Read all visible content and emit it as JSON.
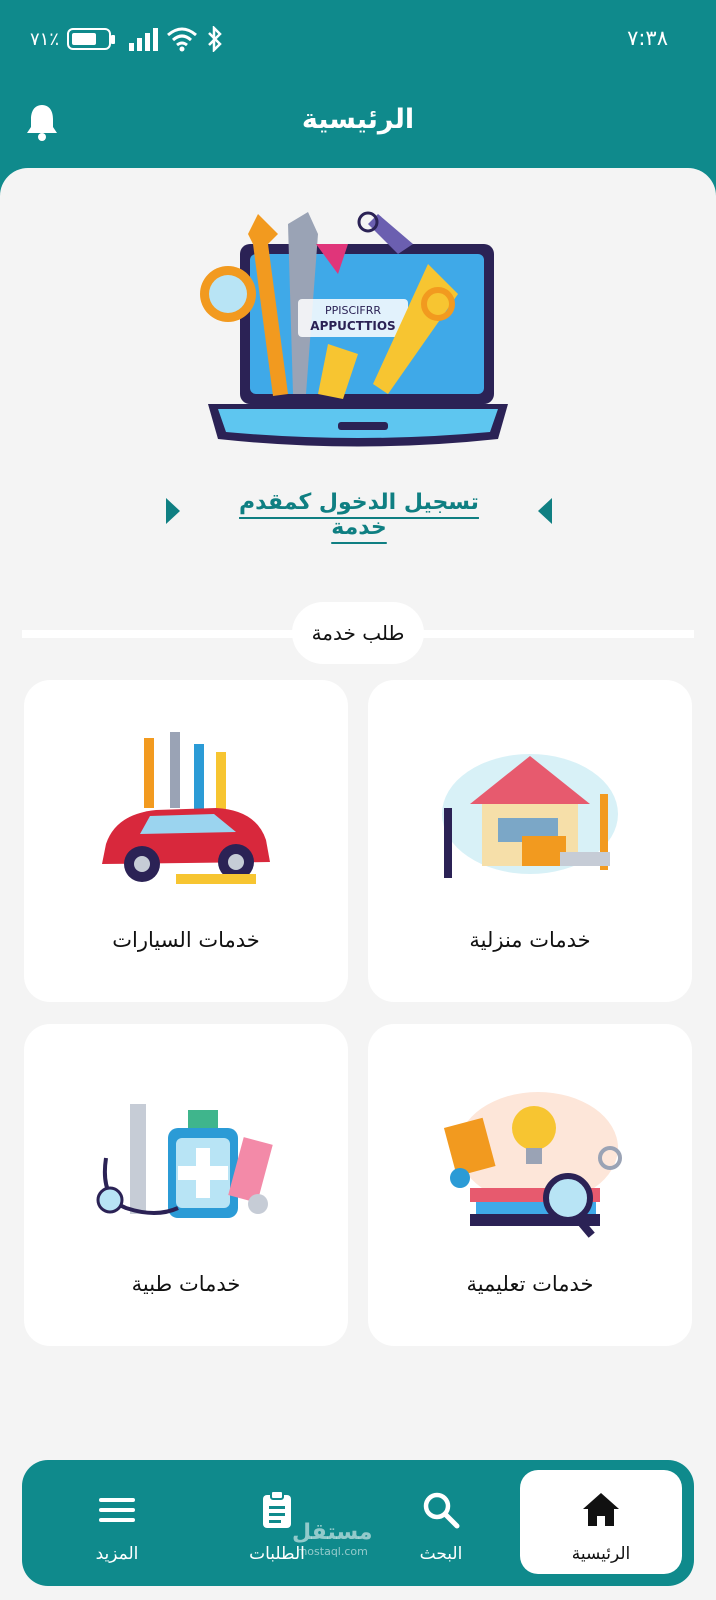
{
  "status_bar": {
    "time": "٧:٣٨",
    "battery_percent_label": "٧١٪",
    "battery_level": 0.71
  },
  "header": {
    "title": "الرئيسية",
    "notification_icon": "bell-icon"
  },
  "hero": {
    "image_text_line1": "PPISCIFRR",
    "image_text_line2": "APPUCTTIOS"
  },
  "login": {
    "link_text": "تسجيل الدخول كمقدم خدمة"
  },
  "section": {
    "title": "طلب خدمة"
  },
  "services": [
    {
      "label": "خدمات منزلية",
      "icon": "home-tools-illustration"
    },
    {
      "label": "خدمات السيارات",
      "icon": "car-tools-illustration"
    },
    {
      "label": "خدمات تعليمية",
      "icon": "education-illustration"
    },
    {
      "label": "خدمات طبية",
      "icon": "medical-illustration"
    }
  ],
  "bottom_nav": {
    "items": [
      {
        "label": "الرئيسية",
        "icon": "home-icon",
        "active": true
      },
      {
        "label": "البحث",
        "icon": "search-icon",
        "active": false
      },
      {
        "label": "الطلبات",
        "icon": "clipboard-icon",
        "active": false
      },
      {
        "label": "المزيد",
        "icon": "menu-icon",
        "active": false
      }
    ]
  },
  "watermark": {
    "main": "مستقل",
    "sub": "mostaql.com"
  },
  "colors": {
    "primary": "#0f8a8c",
    "background": "#f4f4f4",
    "card": "#ffffff",
    "link": "#0f7f82"
  }
}
